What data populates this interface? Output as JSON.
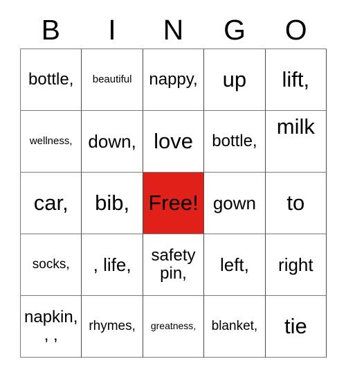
{
  "card": {
    "title": "BINGO",
    "header_letters": [
      "B",
      "I",
      "N",
      "G",
      "O"
    ],
    "free_space_color": "#e2201a",
    "grid_line_color": "#7a7a7a",
    "rows": 5,
    "columns": 5,
    "cells": [
      [
        {
          "text": "bottle,",
          "size": "lg",
          "free": false
        },
        {
          "text": "beautiful",
          "size": "sm",
          "free": false
        },
        {
          "text": "nappy,",
          "size": "lg",
          "free": false
        },
        {
          "text": "up",
          "size": "xxl",
          "free": false
        },
        {
          "text": "lift,",
          "size": "xxl",
          "free": false
        }
      ],
      [
        {
          "text": "wellness,",
          "size": "sm",
          "free": false
        },
        {
          "text": "down,",
          "size": "xl",
          "free": false
        },
        {
          "text": "love",
          "size": "xxl",
          "free": false
        },
        {
          "text": "bottle,",
          "size": "lg",
          "free": false
        },
        {
          "text": "milk",
          "size": "xxl",
          "free": false,
          "valign": "top"
        }
      ],
      [
        {
          "text": "car,",
          "size": "xxl",
          "free": false
        },
        {
          "text": "bib,",
          "size": "xxl",
          "free": false
        },
        {
          "text": "Free!",
          "size": "xxl",
          "free": true
        },
        {
          "text": "gown",
          "size": "xl",
          "free": false
        },
        {
          "text": "to",
          "size": "xxl",
          "free": false
        }
      ],
      [
        {
          "text": "socks,",
          "size": "md",
          "free": false
        },
        {
          "text": ", life,",
          "size": "xl",
          "free": false
        },
        {
          "text": "safety pin,",
          "size": "lg",
          "free": false
        },
        {
          "text": "left,",
          "size": "xl",
          "free": false
        },
        {
          "text": "right",
          "size": "xl",
          "free": false
        }
      ],
      [
        {
          "text": "napkin, , ,",
          "size": "lg",
          "free": false
        },
        {
          "text": "rhymes,",
          "size": "md",
          "free": false
        },
        {
          "text": "greatness,",
          "size": "xs",
          "free": false
        },
        {
          "text": "blanket,",
          "size": "md",
          "free": false
        },
        {
          "text": "tie",
          "size": "xxl",
          "free": false
        }
      ]
    ]
  }
}
